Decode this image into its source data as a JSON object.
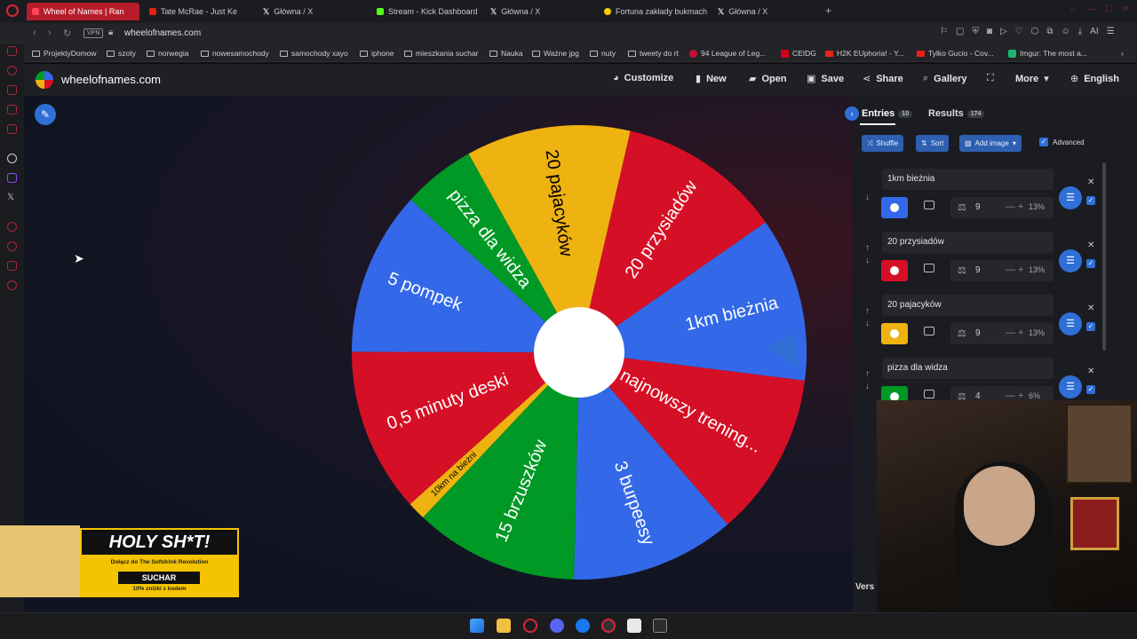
{
  "browser": {
    "tabs": [
      {
        "label": "Wheel of Names | Ran",
        "active": true
      },
      {
        "label": "Tate McRae - Just Ke"
      },
      {
        "label": "Główna / X"
      },
      {
        "label": "Stream - Kick Dashboard"
      },
      {
        "label": "Główna / X"
      },
      {
        "label": "Fortuna zakłady bukmache"
      },
      {
        "label": "Główna / X"
      }
    ],
    "vpn": "VPN",
    "url": "wheelofnames.com",
    "ai_label": "AI",
    "bookmarks": [
      "ProjektyDomow",
      "szoty",
      "norwegia",
      "nowesamochody",
      "samochody xayo",
      "iphone",
      "mieszkania suchar",
      "Nauka",
      "Ważne jpg",
      "nuty",
      "tweety do rt",
      "94 League of Leg...",
      "CEIDG",
      "H2K EUphoria! - Y...",
      "Tylko Gucio - Cov...",
      "Imgur: The most a..."
    ]
  },
  "site": {
    "name": "wheelofnames.com",
    "nav": {
      "customize": "Customize",
      "new": "New",
      "open": "Open",
      "save": "Save",
      "share": "Share",
      "gallery": "Gallery",
      "more": "More",
      "language": "English"
    }
  },
  "wheel": {
    "segments": [
      {
        "label": "20 przysiadów",
        "color": "#d50f25"
      },
      {
        "label": "1km bieżnia",
        "color": "#3369e8"
      },
      {
        "label": "najnowszy trening...",
        "color": "#d50f25"
      },
      {
        "label": "3 burpeesy",
        "color": "#3369e8"
      },
      {
        "label": "15 brzuszków",
        "color": "#009925"
      },
      {
        "label": "10km na bieżni",
        "color": "#eeb211"
      },
      {
        "label": "0,5 minuty deski",
        "color": "#d50f25"
      },
      {
        "label": "5 pompek",
        "color": "#3369e8"
      },
      {
        "label": "pizza dla widza",
        "color": "#009925"
      },
      {
        "label": "20 pajacyków",
        "color": "#eeb211"
      }
    ],
    "weights": [
      9,
      9,
      9,
      9,
      9,
      1,
      9,
      9,
      4,
      9
    ]
  },
  "panel": {
    "entries_tab": "Entries",
    "entries_count": "10",
    "results_tab": "Results",
    "results_count": "174",
    "shuffle": "Shuffle",
    "sort": "Sort",
    "add_image": "Add image",
    "advanced": "Advanced",
    "entries": [
      {
        "name": "1km bieżnia",
        "weight": "9",
        "percent": "13%",
        "color": "#3369e8"
      },
      {
        "name": "20 przysiadów",
        "weight": "9",
        "percent": "13%",
        "color": "#d50f25"
      },
      {
        "name": "20 pajacyków",
        "weight": "9",
        "percent": "13%",
        "color": "#eeb211"
      },
      {
        "name": "pizza dla widza",
        "weight": "4",
        "percent": "6%",
        "color": "#009925"
      }
    ],
    "version_label": "Vers"
  },
  "ad": {
    "headline": "HOLY SH*T!",
    "line1": "Dołącz do The Softdrink Revolution",
    "code": "SUCHAR",
    "line3": "10% zniżki z kodem"
  }
}
